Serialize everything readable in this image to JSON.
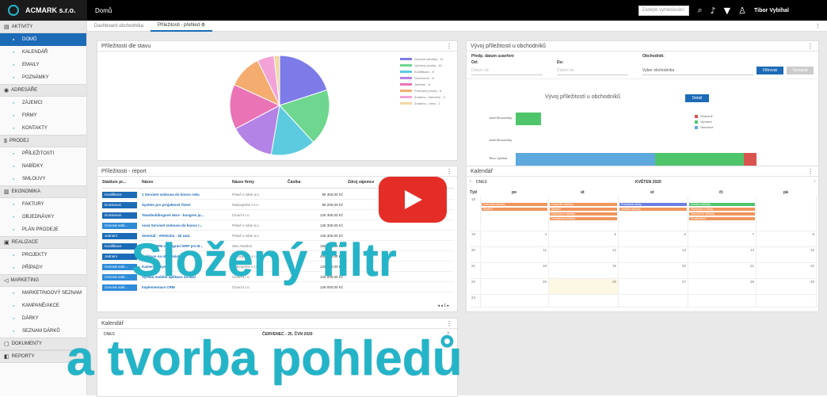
{
  "app": {
    "name": "ACMARK s.r.o.",
    "page_title": "Domů",
    "brand_color": "#1c6bb6",
    "accent_color": "#24b4c8"
  },
  "topbar": {
    "search_placeholder": "Zadejte vyhledávání",
    "user": "Tibor Vybíhal",
    "icons": [
      "search-icon",
      "bell-icon",
      "filter-icon",
      "user-icon"
    ]
  },
  "sidebar": {
    "sections": [
      {
        "label": "AKTIVITY",
        "icon": "calendar-icon",
        "items": [
          {
            "label": "DOMŮ",
            "active": true
          },
          {
            "label": "KALENDÁŘ"
          },
          {
            "label": "EMAILY"
          },
          {
            "label": "POZNÁMKY"
          }
        ]
      },
      {
        "label": "ADRESÁŘE",
        "icon": "contacts-icon",
        "items": [
          {
            "label": "ZÁJEMCI"
          },
          {
            "label": "FIRMY"
          },
          {
            "label": "KONTAKTY"
          }
        ]
      },
      {
        "label": "PRODEJ",
        "icon": "dollar-icon",
        "items": [
          {
            "label": "PŘÍLEŽITOSTI"
          },
          {
            "label": "NABÍDKY"
          },
          {
            "label": "SMLOUVY"
          }
        ]
      },
      {
        "label": "EKONOMIKA",
        "icon": "chart-icon",
        "items": [
          {
            "label": "FAKTURY"
          },
          {
            "label": "OBJEDNÁVKY"
          },
          {
            "label": "PLÁN PRODEJE"
          }
        ]
      },
      {
        "label": "REALIZACE",
        "icon": "briefcase-icon",
        "items": [
          {
            "label": "PROJEKTY"
          },
          {
            "label": "PŘÍPADY"
          }
        ]
      },
      {
        "label": "MARKETING",
        "icon": "megaphone-icon",
        "items": [
          {
            "label": "MARKETINGOVÝ SEZNAM"
          },
          {
            "label": "KAMPANĚ/AKCE"
          },
          {
            "label": "DÁRKY"
          },
          {
            "label": "SEZNAM DÁRKŮ"
          }
        ]
      },
      {
        "label": "DOKUMENTY",
        "icon": "document-icon",
        "items": []
      },
      {
        "label": "REPORTY",
        "icon": "report-icon",
        "items": []
      }
    ]
  },
  "tabs": [
    {
      "label": "Dashboard obchodníka"
    },
    {
      "label": "Příležitosti - přehled ⚙",
      "active": true
    }
  ],
  "panels": {
    "stage": {
      "title": "Příležitosti dle stavu"
    },
    "trend": {
      "title": "Vývoj příležitostí u obchodníků",
      "filter_date_label": "Předp. datum uzavření",
      "from_label": "Od:",
      "from_placeholder": "Datum od",
      "to_label": "Do:",
      "to_placeholder": "Datum do",
      "seller_label": "Obchodník:",
      "seller_placeholder": "Vyber obchodníka",
      "apply_label": "Filtrovat",
      "reset_label": "Vymazat",
      "chart_title": "Vývoj příležitostí u obchodníků",
      "detail_label": "Detail"
    },
    "report": {
      "title": "Příležitosti - report",
      "columns": [
        "Stádium pr...",
        "Název",
        "Název firmy",
        "Částka",
        "Zdroj zájemce"
      ],
      "pagination": "◂ ◂ 1 ▸"
    },
    "calendar": {
      "title": "Kalendář",
      "today_label": "DNES",
      "month_label": "KVĚTEN 2020",
      "days": [
        "Týd",
        "po",
        "út",
        "st",
        "čt",
        "pá"
      ]
    },
    "calendar2": {
      "title": "Kalendář",
      "today_label": "DNES",
      "range_label": "ČERVENEC - 25. ČVN 2020"
    }
  },
  "chart_data": [
    {
      "type": "pie",
      "title": "",
      "slices": [
        {
          "label": "Donové nabídky - 11",
          "value": 11,
          "color": "#7c7be8"
        },
        {
          "label": "Vyhraný prodej - 10",
          "value": 10,
          "color": "#6ed68e"
        },
        {
          "label": "Kvalifikace - 8",
          "value": 8,
          "color": "#5ccbe0"
        },
        {
          "label": "Domluveni - 8",
          "value": 8,
          "color": "#b483e6"
        },
        {
          "label": "Jednání - 8",
          "value": 8,
          "color": "#ea73b5"
        },
        {
          "label": "Prohraný prodej - 6",
          "value": 6,
          "color": "#f4ad6f"
        },
        {
          "label": "Zrušeno - klientem - 3",
          "value": 3,
          "color": "#f3a2d8"
        },
        {
          "label": "Zrušeno - námi - 1",
          "value": 1,
          "color": "#f2d8a0"
        }
      ]
    },
    {
      "type": "bar",
      "title": "Vývoj příležitostí u obchodníků",
      "orientation": "horizontal",
      "categories": [
        "Josef Bruzovsky",
        "Josef Bruzovsky",
        "Tibor Vybíhal"
      ],
      "series": [
        {
          "name": "Otevřené",
          "values": [
            0,
            0,
            11
          ],
          "color": "#5da9dd"
        },
        {
          "name": "Vyhrané",
          "values": [
            2,
            0,
            7
          ],
          "color": "#4fc56b"
        },
        {
          "name": "Ztracené",
          "values": [
            0,
            0,
            1
          ],
          "color": "#d9534f"
        }
      ]
    }
  ],
  "report_rows": [
    {
      "stage": "Kvalifikace",
      "stage_color": "#1c6bb6",
      "name": "1 Serviset smlouva do konce roku",
      "firm": "Právě s námi a.s.",
      "amount": "96 300,00 Kč"
    },
    {
      "stage": "Domluveni",
      "stage_color": "#1c6bb6",
      "name": "Systém pro projektové řízení",
      "firm": "Nakoupíme s.r.o.",
      "amount": "96 200,00 Kč"
    },
    {
      "stage": "Domluveni",
      "stage_color": "#1c6bb6",
      "name": "Teambuildingové akce - kongres ja...",
      "firm": "Cloud s.r.o.",
      "amount": "126 300,00 Kč"
    },
    {
      "stage": "Cenová nabí...",
      "stage_color": "#2d8bd8",
      "name": "nová Serviset smlouva do konce r...",
      "firm": "Právě s námi a.s.",
      "amount": "126 300,00 Kč"
    },
    {
      "stage": "Jednání",
      "stage_color": "#1c6bb6",
      "name": "Seminář - efektivita - 40 zam.",
      "firm": "Právě s námi a.s.",
      "amount": "126 300,00 Kč"
    },
    {
      "stage": "Kvalifikace",
      "stage_color": "#1c6bb6",
      "name": "STAR - CRM s integrací ERP pro B...",
      "firm": "Star Aviation",
      "amount": "150 000,00 Kč"
    },
    {
      "stage": "Jednání",
      "stage_color": "#1c6bb6",
      "name": "Aplikace na objednávky",
      "firm": "Nakoupíme s.r.o.",
      "amount": "400 000,00 Kč"
    },
    {
      "stage": "Cenová nabí...",
      "stage_color": "#2d8bd8",
      "name": "Kamerový systém",
      "firm": "Nakoupíme s.r.o.",
      "amount": "126 000,00 Kč"
    },
    {
      "stage": "Cenová nabí...",
      "stage_color": "#2d8bd8",
      "name": "Výroba mobilní aplikace na bázi",
      "firm": "Cloud s.r.o.",
      "amount": "126 000,00 Kč"
    },
    {
      "stage": "Cenová nabí...",
      "stage_color": "#2d8bd8",
      "name": "Implementace CRM",
      "firm": "Cloud s.r.o.",
      "amount": "126 000,00 Kč"
    }
  ],
  "calendar_weeks": [
    {
      "week": "18",
      "days": [
        "",
        "",
        "",
        "",
        ""
      ]
    },
    {
      "week": "19",
      "days": [
        "4",
        "5",
        "6",
        "7",
        "8"
      ]
    },
    {
      "week": "20",
      "days": [
        "11",
        "12",
        "13",
        "14",
        "15"
      ]
    },
    {
      "week": "21",
      "days": [
        "18",
        "19",
        "20",
        "21",
        "22"
      ]
    },
    {
      "week": "22",
      "days": [
        "25",
        "26",
        "27",
        "28",
        "29"
      ]
    },
    {
      "week": "23",
      "days": [
        "",
        "",
        "",
        "",
        ""
      ]
    }
  ],
  "calendar_events": [
    {
      "day": 0,
      "row": 0,
      "text": "Pokročilé nabídky",
      "color": "#f0955b"
    },
    {
      "day": 0,
      "row": 1,
      "text": "Školení",
      "color": "#f0955b"
    },
    {
      "day": 1,
      "row": 0,
      "text": "Pokročilé nabídky",
      "color": "#f0955b"
    },
    {
      "day": 1,
      "row": 1,
      "text": "Školení",
      "color": "#f0955b"
    },
    {
      "day": 1,
      "row": 2,
      "text": "Dokončení nabídky",
      "color": "#f0955b"
    },
    {
      "day": 1,
      "row": 3,
      "text": "Pravidelné schůzky",
      "color": "#f0955b"
    },
    {
      "day": 2,
      "row": 0,
      "text": "Pravidelné úkoly",
      "color": "#6c7fe0"
    },
    {
      "day": 2,
      "row": 1,
      "text": "Zaslání nabídky",
      "color": "#f0955b"
    },
    {
      "day": 3,
      "row": 0,
      "text": "Úvodní schůzka",
      "color": "#4fc56b"
    },
    {
      "day": 3,
      "row": 1,
      "text": "Informace o rámci",
      "color": "#f0955b"
    },
    {
      "day": 3,
      "row": 2,
      "text": "Dokončení nabídky",
      "color": "#f0955b"
    },
    {
      "day": 3,
      "row": 3,
      "text": "Prodloužení",
      "color": "#f0955b"
    }
  ],
  "overlay": {
    "line1": "Složený filtr",
    "line2": "a tvorba pohledů"
  }
}
